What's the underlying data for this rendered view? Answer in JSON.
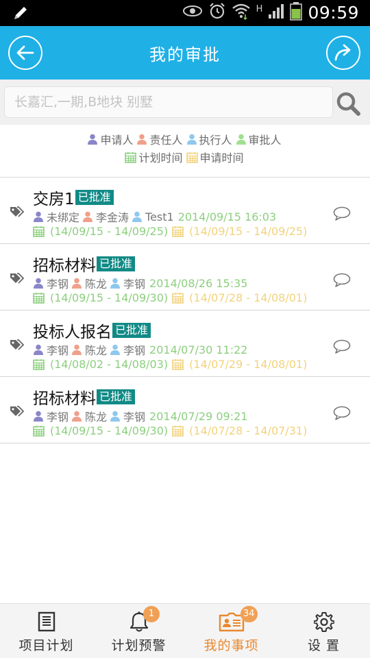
{
  "status_bar": {
    "time": "09:59",
    "network": "H"
  },
  "header": {
    "title": "我的审批"
  },
  "search": {
    "placeholder": "长嘉汇,一期,B地块 别墅"
  },
  "legend": {
    "roles": [
      {
        "label": "申请人",
        "color": "#8a86c8"
      },
      {
        "label": "责任人",
        "color": "#f0a08a"
      },
      {
        "label": "执行人",
        "color": "#8ec8ee"
      },
      {
        "label": "审批人",
        "color": "#9ee08e"
      }
    ],
    "times": [
      {
        "label": "计划时间",
        "color": "#8ccf7e"
      },
      {
        "label": "申请时间",
        "color": "#f2d27c"
      }
    ]
  },
  "items": [
    {
      "title": "交房1",
      "status": "已批准",
      "applicant": "未绑定",
      "responsible": "李金涛",
      "executor": "Test1",
      "timestamp": "2014/09/15 16:03",
      "plan_range": "(14/09/15 - 14/09/25)",
      "apply_range": "(14/09/15 - 14/09/25)"
    },
    {
      "title": "招标材料",
      "status": "已批准",
      "applicant": "李钢",
      "responsible": "陈龙",
      "executor": "李钢",
      "timestamp": "2014/08/26 15:35",
      "plan_range": "(14/09/15 - 14/09/30)",
      "apply_range": "(14/07/28 - 14/08/01)"
    },
    {
      "title": "投标人报名",
      "status": "已批准",
      "applicant": "李钢",
      "responsible": "陈龙",
      "executor": "李钢",
      "timestamp": "2014/07/30 11:22",
      "plan_range": "(14/08/02 - 14/08/03)",
      "apply_range": "(14/07/29 - 14/08/01)"
    },
    {
      "title": "招标材料",
      "status": "已批准",
      "applicant": "李钢",
      "responsible": "陈龙",
      "executor": "李钢",
      "timestamp": "2014/07/29 09:21",
      "plan_range": "(14/09/15 - 14/09/30)",
      "apply_range": "(14/07/28 - 14/07/31)"
    }
  ],
  "bottom_nav": [
    {
      "label": "项目计划",
      "icon": "document-icon",
      "badge": ""
    },
    {
      "label": "计划预警",
      "icon": "bell-icon",
      "badge": "1"
    },
    {
      "label": "我的事项",
      "icon": "id-card-icon",
      "badge": "34",
      "active": true
    },
    {
      "label": "设 置",
      "icon": "gear-icon",
      "badge": ""
    }
  ],
  "colors": {
    "accent": "#1fb0e6",
    "status_badge": "#118a86",
    "nav_active": "#e9882d"
  }
}
